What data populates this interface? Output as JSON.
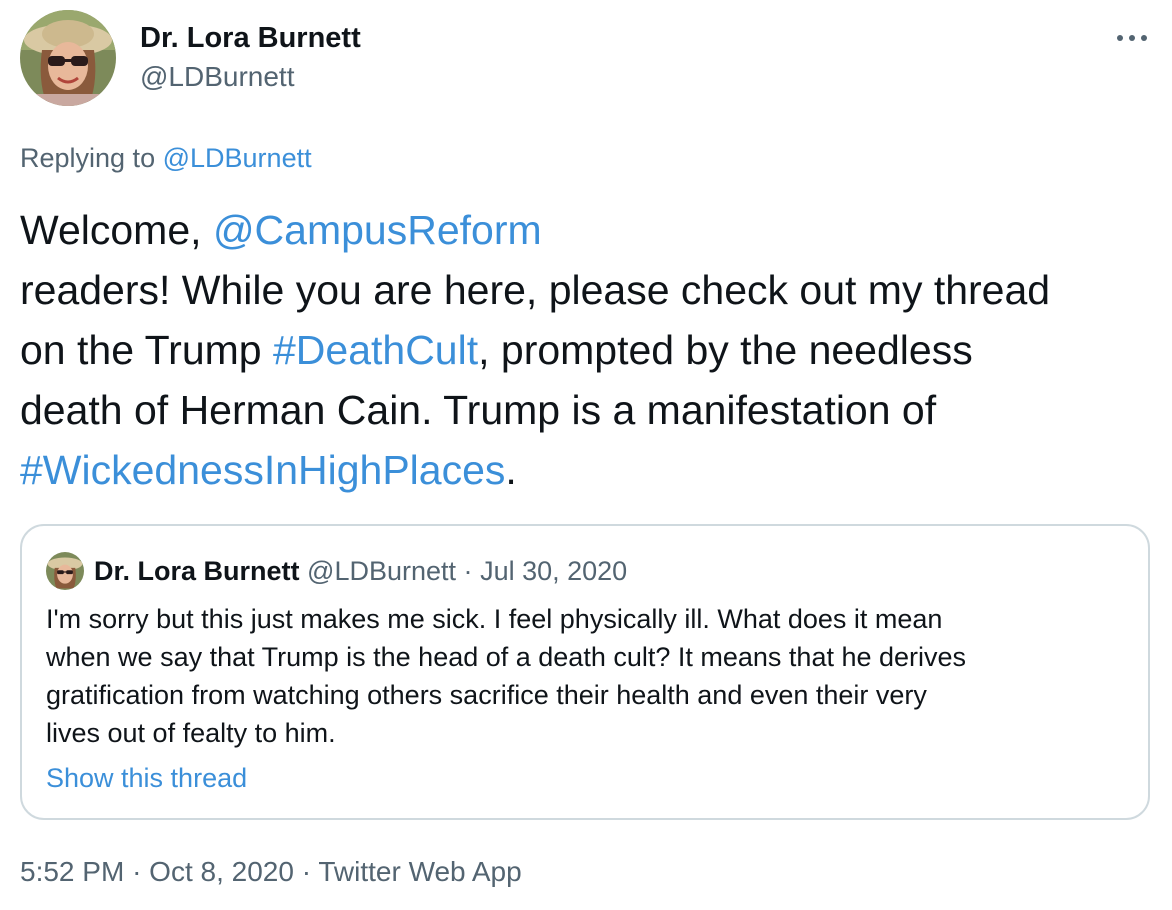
{
  "author": {
    "name": "Dr. Lora Burnett",
    "handle": "@LDBurnett"
  },
  "more_icon": "more-dots-icon",
  "reply_context": {
    "prefix": "Replying to",
    "handle": "@LDBurnett"
  },
  "tweet": {
    "line1_text": "Welcome,",
    "mention": "@CampusReform",
    "line2_text": " readers! While you are here, please check out my thread",
    "line3_prefix": "on the Trump",
    "hashtag1": "#DeathCult",
    "line3_suffix": ", prompted by the needless",
    "line4_text": "death of Herman Cain. Trump is a manifestation of",
    "hashtag2": "#WickednessInHighPlaces",
    "line5_suffix": "."
  },
  "quote": {
    "name": "Dr. Lora Burnett",
    "handle": "@LDBurnett",
    "separator": "·",
    "date": "Jul 30, 2020",
    "lines": [
      "I'm sorry but this just makes me sick. I feel physically ill. What does it mean",
      "when we say that Trump is the head of a death cult? It means that he derives",
      "gratification from watching others sacrifice their health and even their very",
      "lives out of fealty to him."
    ],
    "show_thread": "Show this thread"
  },
  "meta": {
    "time": "5:52 PM",
    "separator": "·",
    "date": "Oct 8, 2020",
    "separator2": "·",
    "source": "Twitter Web App"
  },
  "colors": {
    "link": "#3b8fd9",
    "secondary_text": "#536471",
    "primary_text": "#0f1419",
    "border": "#cfd9de"
  }
}
